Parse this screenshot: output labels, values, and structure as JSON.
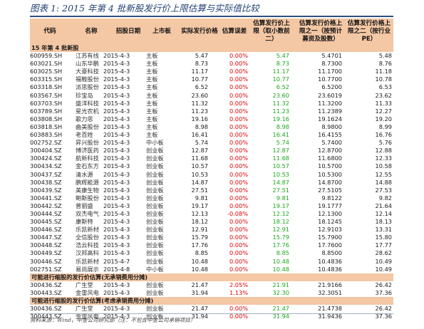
{
  "title": "图表 1: 2015 年第 4 批新股发行价上限估算与实际值比较",
  "headers": {
    "code": "代码",
    "name": "名称",
    "date": "招股日期",
    "board": "上市板",
    "price": "实际发行价格",
    "error": "估算误差",
    "upper": [
      "估算发行价上",
      "限（取小数前",
      "二）"
    ],
    "upper2": [
      "估算发行价格上",
      "限之一（按预计",
      "募资及股数）"
    ],
    "pe": [
      "估算发行价格上",
      "限之二（按行业",
      "PE）"
    ]
  },
  "sections": {
    "batch": "15 年第 4 批新股",
    "no_fee": "可能进行缩股的发行价估算(无承销费用分摊)",
    "with_fee": "可能进行缩股的发行价估算(考虑承销费用分摊)"
  },
  "rows_main": [
    {
      "code": "600959.SH",
      "name": "江苏有线",
      "date": "2015-4-3",
      "board": "主板",
      "price": "5.47",
      "error": "0.00%",
      "upper": "5.47",
      "upper2": "5.4701",
      "pe": "5.48"
    },
    {
      "code": "603021.SH",
      "name": "山东华鹏",
      "date": "2015-4-3",
      "board": "主板",
      "price": "8.73",
      "error": "0.00%",
      "upper": "8.73",
      "upper2": "8.7300",
      "pe": "8.76"
    },
    {
      "code": "603025.SH",
      "name": "大豪科技",
      "date": "2015-4-3",
      "board": "主板",
      "price": "11.17",
      "error": "0.00%",
      "upper": "11.17",
      "upper2": "11.1700",
      "pe": "11.18"
    },
    {
      "code": "603315.SH",
      "name": "福鞍股份",
      "date": "2015-4-3",
      "board": "主板",
      "price": "10.77",
      "error": "0.00%",
      "upper": "10.77",
      "upper2": "10.7700",
      "pe": "10.78"
    },
    {
      "code": "603318.SH",
      "name": "派思股份",
      "date": "2015-4-3",
      "board": "主板",
      "price": "6.52",
      "error": "0.00%",
      "upper": "6.52",
      "upper2": "6.5200",
      "pe": "6.53"
    },
    {
      "code": "603567.SH",
      "name": "珍宝岛",
      "date": "2015-4-3",
      "board": "主板",
      "price": "23.60",
      "error": "0.00%",
      "upper": "23.60",
      "upper2": "23.6019",
      "pe": "23.62"
    },
    {
      "code": "603703.SH",
      "name": "盛洋科技",
      "date": "2015-4-3",
      "board": "主板",
      "price": "11.32",
      "error": "0.00%",
      "upper": "11.32",
      "upper2": "11.3200",
      "pe": "11.33"
    },
    {
      "code": "603789.SH",
      "name": "星光农机",
      "date": "2015-4-3",
      "board": "主板",
      "price": "11.23",
      "error": "0.00%",
      "upper": "11.23",
      "upper2": "11.2389",
      "pe": "12.27"
    },
    {
      "code": "603808.SH",
      "name": "歌力思",
      "date": "2015-4-3",
      "board": "主板",
      "price": "19.16",
      "error": "0.00%",
      "upper": "19.16",
      "upper2": "19.1624",
      "pe": "19.20"
    },
    {
      "code": "603818.SH",
      "name": "曲美股份",
      "date": "2015-4-3",
      "board": "主板",
      "price": "8.98",
      "error": "0.00%",
      "upper": "8.98",
      "upper2": "8.9800",
      "pe": "8.99"
    },
    {
      "code": "603883.SH",
      "name": "老百姓",
      "date": "2015-4-3",
      "board": "主板",
      "price": "16.41",
      "error": "0.00%",
      "upper": "16.41",
      "upper2": "16.4155",
      "pe": "16.76"
    },
    {
      "code": "002752.SZ",
      "name": "昇兴股份",
      "date": "2015-4-3",
      "board": "中小板",
      "price": "5.74",
      "error": "0.00%",
      "upper": "5.74",
      "upper2": "5.7400",
      "pe": "5.76"
    },
    {
      "code": "300404.SZ",
      "name": "博济医药",
      "date": "2015-4-3",
      "board": "创业板",
      "price": "12.87",
      "error": "0.00%",
      "upper": "12.87",
      "upper2": "12.8700",
      "pe": "12.88"
    },
    {
      "code": "300424.SZ",
      "name": "航新科技",
      "date": "2015-4-3",
      "board": "创业板",
      "price": "11.68",
      "error": "0.00%",
      "upper": "11.68",
      "upper2": "11.6800",
      "pe": "12.33"
    },
    {
      "code": "300434.SZ",
      "name": "金石东方",
      "date": "2015-4-3",
      "board": "创业板",
      "price": "10.57",
      "error": "0.00%",
      "upper": "10.57",
      "upper2": "10.5700",
      "pe": "10.58"
    },
    {
      "code": "300437.SZ",
      "name": "清水源",
      "date": "2015-4-3",
      "board": "创业板",
      "price": "10.53",
      "error": "0.00%",
      "upper": "10.53",
      "upper2": "10.5300",
      "pe": "12.55"
    },
    {
      "code": "300438.SZ",
      "name": "鹏辉能源",
      "date": "2015-4-3",
      "board": "创业板",
      "price": "14.87",
      "error": "0.00%",
      "upper": "14.87",
      "upper2": "14.8700",
      "pe": "14.88"
    },
    {
      "code": "300439.SZ",
      "name": "美康生物",
      "date": "2015-4-3",
      "board": "创业板",
      "price": "27.51",
      "error": "0.00%",
      "upper": "27.51",
      "upper2": "27.5105",
      "pe": "27.53"
    },
    {
      "code": "300441.SZ",
      "name": "鲍斯股份",
      "date": "2015-4-3",
      "board": "创业板",
      "price": "9.81",
      "error": "0.00%",
      "upper": "9.81",
      "upper2": "9.8122",
      "pe": "9.82"
    },
    {
      "code": "300442.SZ",
      "name": "普丽盛",
      "date": "2015-4-3",
      "board": "创业板",
      "price": "19.17",
      "error": "0.00%",
      "upper": "19.17",
      "upper2": "19.1777",
      "pe": "21.64"
    },
    {
      "code": "300444.SZ",
      "name": "双杰电气",
      "date": "2015-4-3",
      "board": "创业板",
      "price": "12.13",
      "error": "-0.08%",
      "upper": "12.12",
      "upper2": "12.1300",
      "pe": "12.14"
    },
    {
      "code": "300445.SZ",
      "name": "康斯特",
      "date": "2015-4-3",
      "board": "创业板",
      "price": "18.12",
      "error": "0.00%",
      "upper": "18.12",
      "upper2": "18.1245",
      "pe": "18.13"
    },
    {
      "code": "300446.SZ",
      "name": "乐凯新材",
      "date": "2015-4-3",
      "board": "创业板",
      "price": "12.91",
      "error": "0.00%",
      "upper": "12.91",
      "upper2": "12.9103",
      "pe": "13.31"
    },
    {
      "code": "300447.SZ",
      "name": "全信股份",
      "date": "2015-4-3",
      "board": "创业板",
      "price": "15.79",
      "error": "0.00%",
      "upper": "15.79",
      "upper2": "15.7900",
      "pe": "15.80"
    },
    {
      "code": "300448.SZ",
      "name": "浩云科技",
      "date": "2015-4-3",
      "board": "创业板",
      "price": "17.76",
      "error": "0.00%",
      "upper": "17.76",
      "upper2": "17.7600",
      "pe": "17.77"
    },
    {
      "code": "300449.SZ",
      "name": "汉邦高科",
      "date": "2015-4-3",
      "board": "创业板",
      "price": "8.85",
      "error": "0.00%",
      "upper": "8.85",
      "upper2": "8.8500",
      "pe": "28.62"
    },
    {
      "code": "300446.SZ",
      "name": "乐凯新材",
      "date": "2015-4-7",
      "board": "创业板",
      "price": "10.48",
      "error": "0.00%",
      "upper": "10.48",
      "upper2": "10.4836",
      "pe": "10.49"
    },
    {
      "code": "002751.SZ",
      "name": "易尚展示",
      "date": "2015-4-8",
      "board": "中小板",
      "price": "10.48",
      "error": "0.00%",
      "upper": "10.48",
      "upper2": "10.4836",
      "pe": "10.49"
    }
  ],
  "rows_no_fee": [
    {
      "code": "300436.SZ",
      "name": "广生堂",
      "date": "2015-4-3",
      "board": "创业板",
      "price": "21.47",
      "error": "2.05%",
      "upper": "21.91",
      "upper2": "21.9166",
      "pe": "26.42"
    },
    {
      "code": "300443.SZ",
      "name": "金雷风电",
      "date": "2015-4-3",
      "board": "创业板",
      "price": "31.94",
      "error": "1.13%",
      "upper": "32.30",
      "upper2": "32.3051",
      "pe": "37.36"
    }
  ],
  "rows_with_fee": [
    {
      "code": "300436.SZ",
      "name": "广生堂",
      "date": "2015-4-3",
      "board": "创业板",
      "price": "21.47",
      "error": "0.00%",
      "upper": "21.47",
      "upper2": "21.4738",
      "pe": "26.42"
    },
    {
      "code": "300443.SZ",
      "name": "金雷风电",
      "date": "2015-4-3",
      "board": "创业板",
      "price": "31.94",
      "error": "0.00%",
      "upper": "31.94",
      "upper2": "31.9436",
      "pe": "37.36"
    }
  ],
  "footer": "资料来源：Wind，中金公司研究部（注：不包含中金公司承销项目）"
}
